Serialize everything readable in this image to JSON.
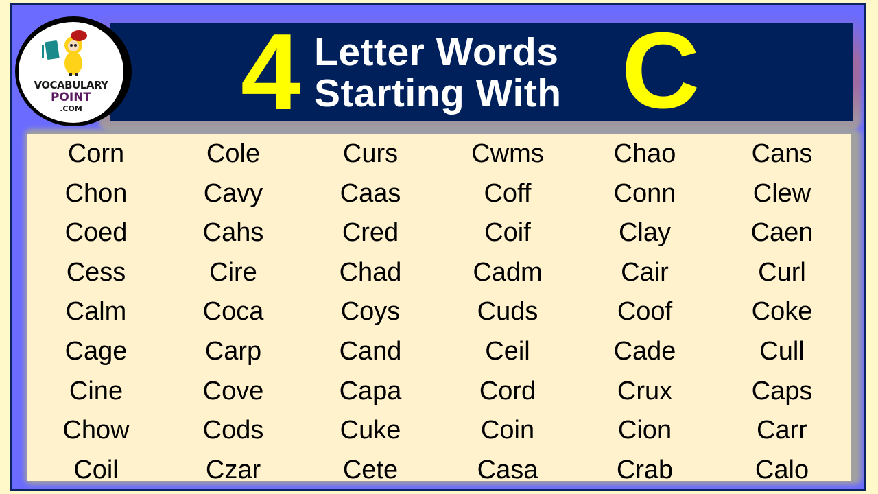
{
  "header": {
    "number": "4",
    "line1": "Letter Words",
    "line2": "Starting With",
    "letter": "C"
  },
  "logo": {
    "line1": "VOCABULARY",
    "line2": "POINT",
    "line3": ".COM"
  },
  "colors": {
    "banner": "#00205b",
    "accent_yellow": "#ffff00",
    "frame_blue": "#6b6bff",
    "grid_bg": "#fff2cc",
    "logo_point_purple": "#5a1a60"
  },
  "words": [
    "Corn",
    "Cole",
    "Curs",
    "Cwms",
    "Chao",
    "Cans",
    "Chon",
    "Cavy",
    "Caas",
    "Coff",
    "Conn",
    "Clew",
    "Coed",
    "Cahs",
    "Cred",
    "Coif",
    "Clay",
    "Caen",
    "Cess",
    "Cire",
    "Chad",
    "Cadm",
    "Cair",
    "Curl",
    "Calm",
    "Coca",
    "Coys",
    "Cuds",
    "Coof",
    "Coke",
    "Cage",
    "Carp",
    "Cand",
    "Ceil",
    "Cade",
    "Cull",
    "Cine",
    "Cove",
    "Capa",
    "Cord",
    "Crux",
    "Caps",
    "Chow",
    "Cods",
    "Cuke",
    "Coin",
    "Cion",
    "Carr",
    "Coil",
    "Czar",
    "Cete",
    "Casa",
    "Crab",
    "Calo"
  ]
}
